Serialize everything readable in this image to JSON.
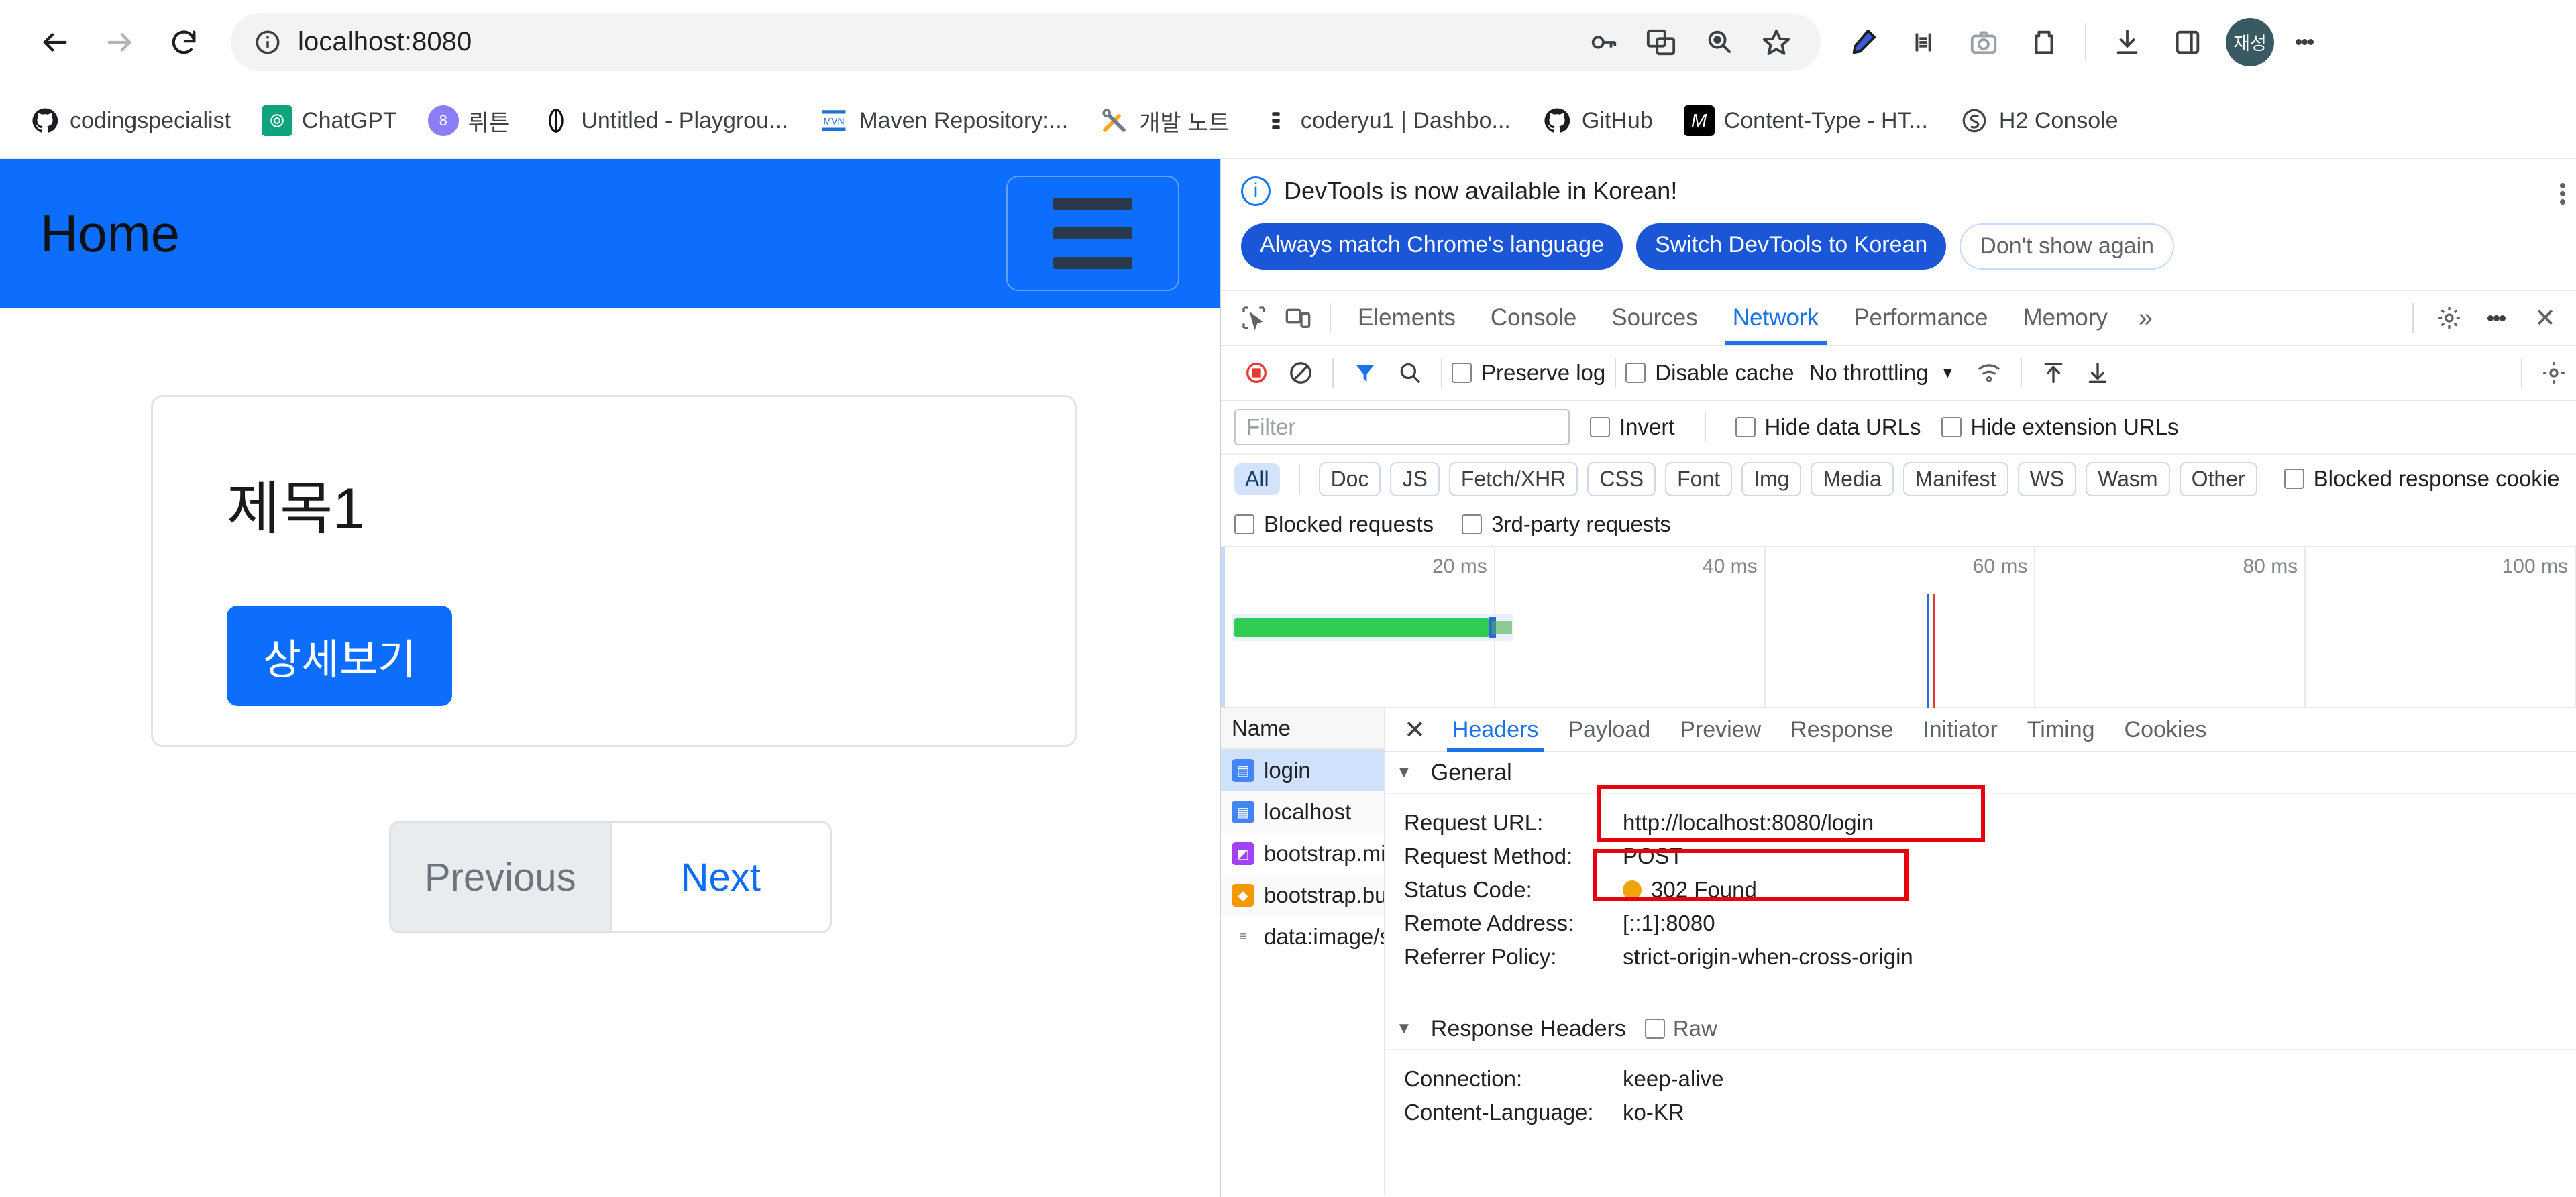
{
  "browser": {
    "url": "localhost:8080",
    "nav": {
      "back": "back-arrow",
      "forward": "forward-arrow",
      "reload": "reload"
    },
    "omni_icons": [
      "password-key-icon",
      "translate-icon",
      "search-zoom-icon",
      "bookmark-star-icon"
    ],
    "toolbar_icons": [
      "pen-highlighter-icon",
      "extension-puzzle-icon",
      "screenshot-camera-icon",
      "extensions-icon",
      "downloads-icon",
      "side-panel-icon"
    ],
    "avatar_label": "재성"
  },
  "bookmarks": [
    {
      "label": "codingspecialist",
      "icon": "github-icon"
    },
    {
      "label": "ChatGPT",
      "icon": "chatgpt-icon"
    },
    {
      "label": "뤼튼",
      "icon": "wrtn-icon"
    },
    {
      "label": "Untitled - Playgrou...",
      "icon": "playground-icon"
    },
    {
      "label": "Maven Repository:...",
      "icon": "maven-icon"
    },
    {
      "label": "개발 노트",
      "icon": "tools-icon"
    },
    {
      "label": "coderyu1 | Dashbo...",
      "icon": "dashboard-icon"
    },
    {
      "label": "GitHub",
      "icon": "github-icon"
    },
    {
      "label": "Content-Type - HT...",
      "icon": "medium-icon"
    },
    {
      "label": "H2 Console",
      "icon": "h2-icon"
    }
  ],
  "page": {
    "brand": "Home",
    "card": {
      "title": "제목1",
      "button": "상세보기"
    },
    "pager": {
      "previous": "Previous",
      "next": "Next"
    }
  },
  "devtools": {
    "notice": {
      "text": "DevTools is now available in Korean!",
      "buttons": [
        "Always match Chrome's language",
        "Switch DevTools to Korean",
        "Don't show again"
      ]
    },
    "tabs": [
      "Elements",
      "Console",
      "Sources",
      "Network",
      "Performance",
      "Memory"
    ],
    "active_tab": "Network",
    "more_tabs": "»",
    "toolbar": {
      "record_icon": "record-stop-icon",
      "clear_icon": "clear-icon",
      "filter_icon": "filter-icon",
      "search_icon": "search-icon",
      "preserve_log": "Preserve log",
      "disable_cache": "Disable cache",
      "throttling": "No throttling",
      "import_icon": "import-har-icon",
      "export_icon": "export-har-icon",
      "wifi_icon": "network-conditions-icon",
      "settings_icon": "gear-icon",
      "kebab_icon": "kebab-menu-icon",
      "close_icon": "close-icon"
    },
    "filter": {
      "placeholder": "Filter",
      "invert": "Invert",
      "hide_data_urls": "Hide data URLs",
      "hide_extension_urls": "Hide extension URLs",
      "blocked_response_cookies": "Blocked response cookie",
      "blocked_requests": "Blocked requests",
      "third_party_requests": "3rd-party requests"
    },
    "types": [
      "All",
      "Doc",
      "JS",
      "Fetch/XHR",
      "CSS",
      "Font",
      "Img",
      "Media",
      "Manifest",
      "WS",
      "Wasm",
      "Other"
    ],
    "active_type": "All",
    "overview": {
      "ticks": [
        "20 ms",
        "40 ms",
        "60 ms",
        "80 ms",
        "100 ms"
      ]
    },
    "requests": {
      "column": "Name",
      "rows": [
        {
          "name": "login",
          "icon": "document-icon",
          "selected": true
        },
        {
          "name": "localhost",
          "icon": "document-icon",
          "selected": false
        },
        {
          "name": "bootstrap.mi...",
          "icon": "css-map-icon",
          "selected": false
        },
        {
          "name": "bootstrap.bu...",
          "icon": "js-icon",
          "selected": false
        },
        {
          "name": "data:image/s...",
          "icon": "data-url-icon",
          "selected": false
        }
      ]
    },
    "detail": {
      "close": "✕",
      "tabs": [
        "Headers",
        "Payload",
        "Preview",
        "Response",
        "Initiator",
        "Timing",
        "Cookies"
      ],
      "active_tab": "Headers",
      "general_label": "General",
      "general": [
        {
          "key": "Request URL:",
          "value": "http://localhost:8080/login",
          "highlighted": true
        },
        {
          "key": "Request Method:",
          "value": "POST",
          "highlighted": false
        },
        {
          "key": "Status Code:",
          "value": "302 Found",
          "highlighted": true,
          "status_dot": "#f0a30a"
        },
        {
          "key": "Remote Address:",
          "value": "[::1]:8080",
          "highlighted": false
        },
        {
          "key": "Referrer Policy:",
          "value": "strict-origin-when-cross-origin",
          "highlighted": false
        }
      ],
      "response_headers_label": "Response Headers",
      "raw_label": "Raw",
      "response_headers": [
        {
          "key": "Connection:",
          "value": "keep-alive"
        },
        {
          "key": "Content-Language:",
          "value": "ko-KR"
        }
      ]
    }
  }
}
